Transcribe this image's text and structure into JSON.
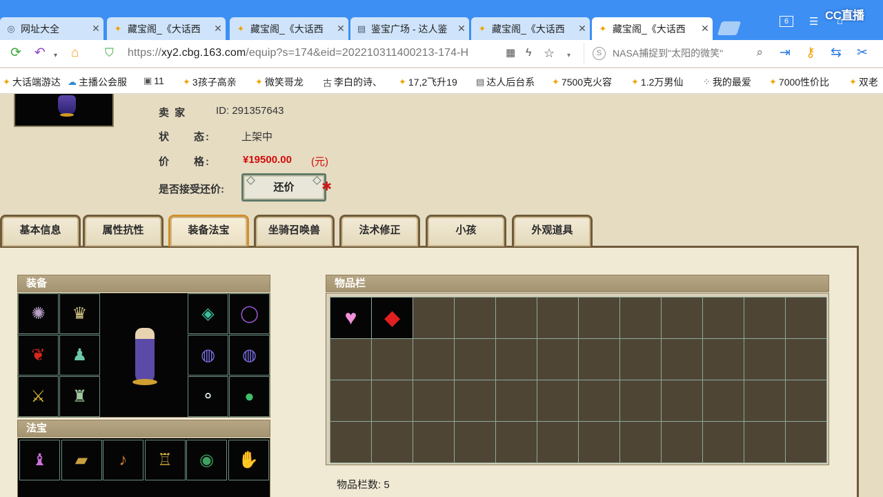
{
  "browser": {
    "tabs": [
      {
        "title": "网址大全",
        "icon": "globe-icon",
        "active": false
      },
      {
        "title": "藏宝阁_《大话西",
        "icon": "chick-icon",
        "active": false
      },
      {
        "title": "藏宝阁_《大话西",
        "icon": "chick-icon",
        "active": false
      },
      {
        "title": "鉴宝广场 - 达人鉴",
        "icon": "doc-icon",
        "active": false
      },
      {
        "title": "藏宝阁_《大话西",
        "icon": "chick-icon",
        "active": false
      },
      {
        "title": "藏宝阁_《大话西",
        "icon": "chick-icon",
        "active": true
      }
    ],
    "tab_count": "6",
    "overlay_logo": "CC直播",
    "url_prefix": "https://",
    "url_host": "xy2.cbg.163.com",
    "url_rest": "/equip?s=174&eid=202210311400213-174-H",
    "search_placeholder": "NASA捕捉到\"太阳的微笑\"",
    "bookmarks": [
      {
        "label": "大话端游达",
        "icon": "chick-icon"
      },
      {
        "label": "主播公会服",
        "icon": "cloud-icon"
      },
      {
        "label": "11",
        "icon": "image-icon"
      },
      {
        "label": "3孩子高亲",
        "icon": "chick-icon"
      },
      {
        "label": "微笑哥龙",
        "icon": "chick-icon"
      },
      {
        "label": "李白的诗、",
        "icon": "poem-icon"
      },
      {
        "label": "17,2飞升19",
        "icon": "chick-icon"
      },
      {
        "label": "达人后台系",
        "icon": "doc-icon"
      },
      {
        "label": "7500克火容",
        "icon": "chick-icon"
      },
      {
        "label": "1.2万男仙",
        "icon": "chick-icon"
      },
      {
        "label": "我的最爱",
        "icon": "grid-icon"
      },
      {
        "label": "7000性价比",
        "icon": "chick-icon"
      },
      {
        "label": "双老",
        "icon": "chick-icon"
      }
    ]
  },
  "listing": {
    "seller_label": "卖 家",
    "seller_value": "ID: 291357643",
    "status_label": "状　　态:",
    "status_value": "上架中",
    "price_label": "价　　格:",
    "price_value": "¥19500.00",
    "price_unit": "(元)",
    "counter_label": "是否接受还价:",
    "counter_button": "还价"
  },
  "game_tabs": [
    {
      "label": "基本信息",
      "active": false
    },
    {
      "label": "属性抗性",
      "active": false
    },
    {
      "label": "装备法宝",
      "active": true
    },
    {
      "label": "坐骑召唤兽",
      "active": false
    },
    {
      "label": "法术修正",
      "active": false
    },
    {
      "label": "小孩",
      "active": false
    },
    {
      "label": "外观道具",
      "active": false
    }
  ],
  "equipment": {
    "title": "装备",
    "left_slots": [
      "tentacle-item",
      "helmet-item",
      "red-cape-item",
      "green-armor-item",
      "gold-weapon-item",
      "boots-item"
    ],
    "right_slots": [
      "mask-item",
      "necklace-item",
      "ring-item",
      "ring-item",
      "bracelet-item",
      "jade-orb-item"
    ]
  },
  "treasure": {
    "title": "法宝",
    "slots": [
      "lantern-item",
      "seal-item",
      "pipa-item",
      "tower-item",
      "mirror-item",
      "claw-item"
    ]
  },
  "inventory": {
    "title": "物品栏",
    "items": [
      "pink-heart-item",
      "red-gem-item"
    ],
    "count_label": "物品栏数: 5"
  },
  "colors": {
    "browser_blue": "#3d8ff3",
    "page_bg": "#e5dcc2",
    "price_red": "#d40a0a",
    "active_tab_border": "#d18e2a"
  }
}
